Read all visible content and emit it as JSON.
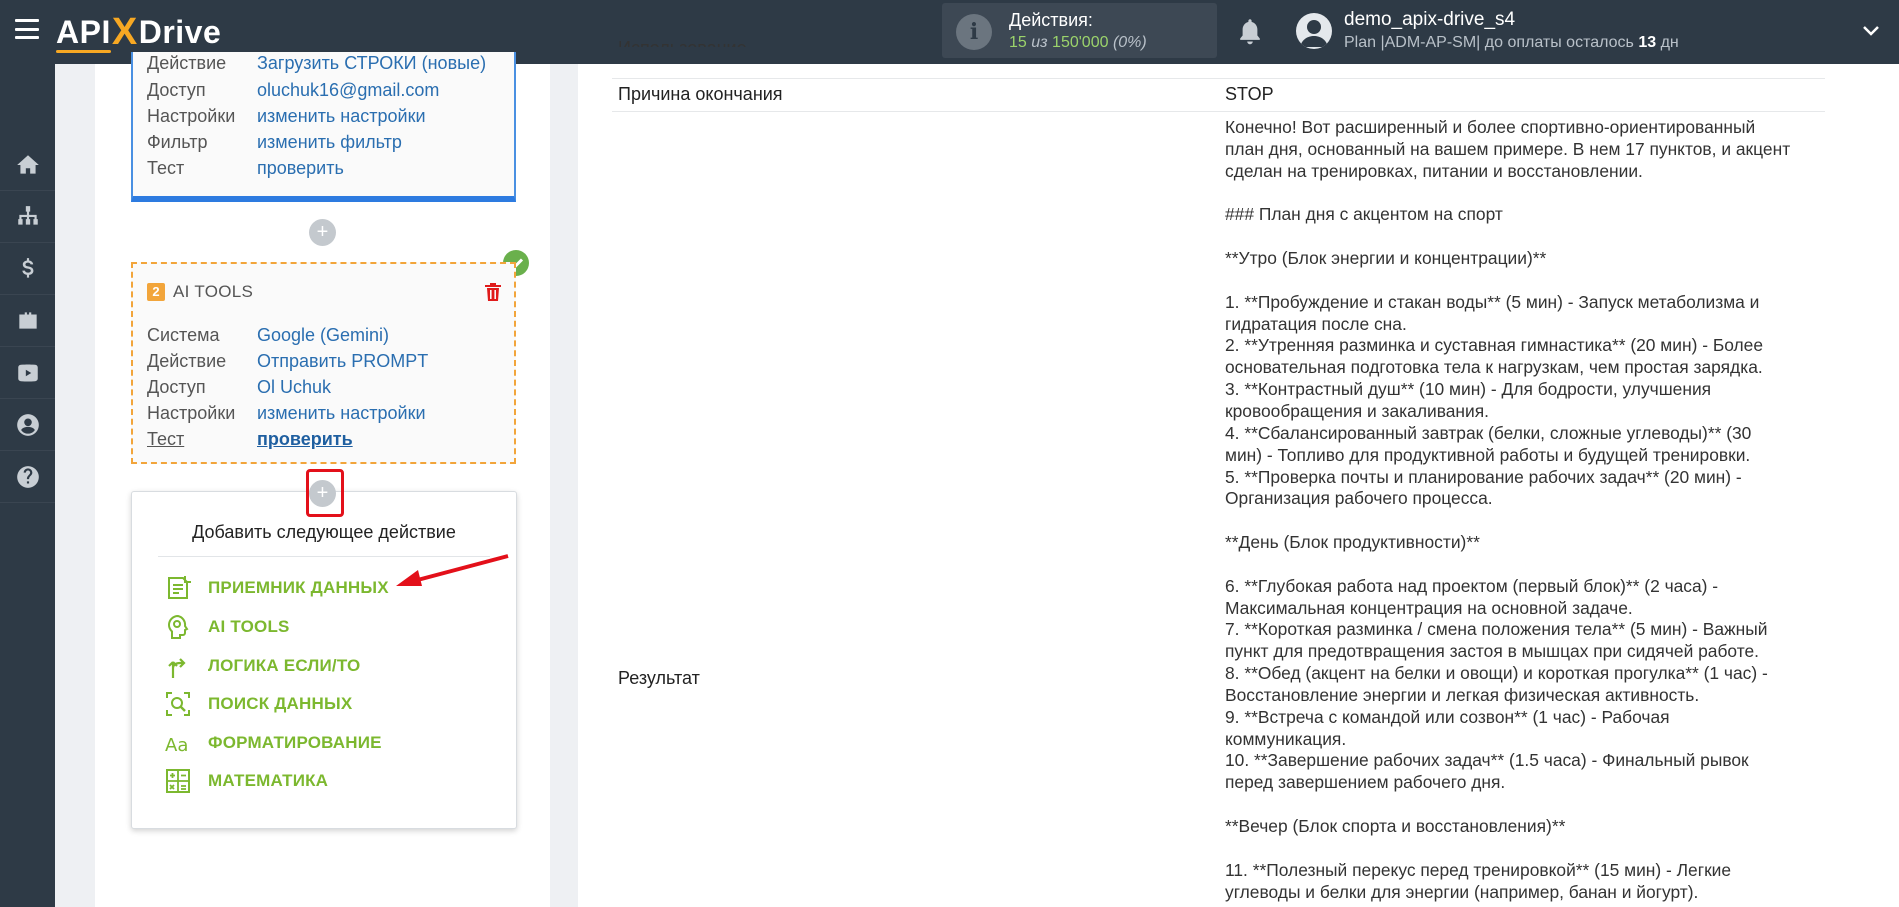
{
  "header": {
    "logo_api": "API",
    "logo_x": "X",
    "logo_drive": "Drive",
    "actions_title": "Действия:",
    "actions_used": "15",
    "actions_of": "из",
    "actions_total": "150'000",
    "actions_percent": "(0%)",
    "user_name": "demo_apix-drive_s4",
    "plan_text": "Plan |ADM-AP-SM| до оплаты осталось",
    "plan_days": "13",
    "plan_days_unit": "дн"
  },
  "sidebar": {
    "items": [
      {
        "icon": "home-icon"
      },
      {
        "icon": "sitemap-icon"
      },
      {
        "icon": "dollar-icon"
      },
      {
        "icon": "briefcase-icon"
      },
      {
        "icon": "youtube-icon"
      },
      {
        "icon": "user-icon"
      },
      {
        "icon": "help-icon"
      }
    ]
  },
  "block1": {
    "rows": [
      {
        "label": "Действие",
        "value": "Загрузить СТРОКИ (новые)"
      },
      {
        "label": "Доступ",
        "value": "oluchuk16@gmail.com"
      },
      {
        "label": "Настройки",
        "value": "изменить настройки"
      },
      {
        "label": "Фильтр",
        "value": "изменить фильтр"
      },
      {
        "label": "Тест",
        "value": "проверить"
      }
    ]
  },
  "block2": {
    "number": "2",
    "title": "AI TOOLS",
    "rows": [
      {
        "label": "Система",
        "value": "Google (Gemini)"
      },
      {
        "label": "Действие",
        "value": "Отправить PROMPT"
      },
      {
        "label": "Доступ",
        "value": "Ol Uchuk"
      },
      {
        "label": "Настройки",
        "value": "изменить настройки"
      },
      {
        "label": "Тест",
        "value": "проверить"
      }
    ]
  },
  "plus_symbol": "+",
  "add_box": {
    "title": "Добавить следующее действие",
    "items": [
      {
        "label": "ПРИЕМНИК ДАННЫХ",
        "icon": "data-receiver-icon"
      },
      {
        "label": "AI TOOLS",
        "icon": "ai-tools-icon"
      },
      {
        "label": "ЛОГИКА ЕСЛИ/ТО",
        "icon": "logic-icon"
      },
      {
        "label": "ПОИСК ДАННЫХ",
        "icon": "search-data-icon"
      },
      {
        "label": "ФОРМАТИРОВАНИЕ",
        "icon": "formatting-icon"
      },
      {
        "label": "МАТЕМАТИКА",
        "icon": "math-icon"
      }
    ]
  },
  "details": {
    "cut_label": "Использование",
    "finish_reason_label": "Причина окончания",
    "finish_reason_value": "STOP",
    "result_label": "Результат",
    "result_lines": [
      "Конечно! Вот расширенный и более спортивно-ориентированный",
      "план дня, основанный на вашем примере. В нем 17 пунктов, и акцент",
      "сделан на тренировках, питании и восстановлении.",
      "",
      "### План дня с акцентом на спорт",
      "",
      "**Утро (Блок энергии и концентрации)**",
      "",
      "1. **Пробуждение и стакан воды** (5 мин) - Запуск метаболизма и",
      "гидратация после сна.",
      "2. **Утренняя разминка и суставная гимнастика** (20 мин) - Более",
      "основательная подготовка тела к нагрузкам, чем простая зарядка.",
      "3. **Контрастный душ** (10 мин) - Для бодрости, улучшения",
      "кровообращения и закаливания.",
      "4. **Сбалансированный завтрак (белки, сложные углеводы)** (30",
      "мин) - Топливо для продуктивной работы и будущей тренировки.",
      "5. **Проверка почты и планирование рабочих задач** (20 мин) -",
      "Организация рабочего процесса.",
      "",
      "**День (Блок продуктивности)**",
      "",
      "6. **Глубокая работа над проектом (первый блок)** (2 часа) -",
      "Максимальная концентрация на основной задаче.",
      "7. **Короткая разминка / смена положения тела** (5 мин) - Важный",
      "пункт для предотвращения застоя в мышцах при сидячей работе.",
      "8. **Обед (акцент на белки и овощи) и короткая прогулка** (1 час) -",
      "Восстановление энергии и легкая физическая активность.",
      "9. **Встреча с командой или созвон** (1 час) - Рабочая",
      "коммуникация.",
      "10. **Завершение рабочих задач** (1.5 часа) - Финальный рывок",
      "перед завершением рабочего дня.",
      "",
      "**Вечер (Блок спорта и восстановления)**",
      "",
      "11. **Полезный перекус перед тренировкой** (15 мин) - Легкие",
      "углеводы и белки для энергии (например, банан и йогурт)."
    ]
  }
}
